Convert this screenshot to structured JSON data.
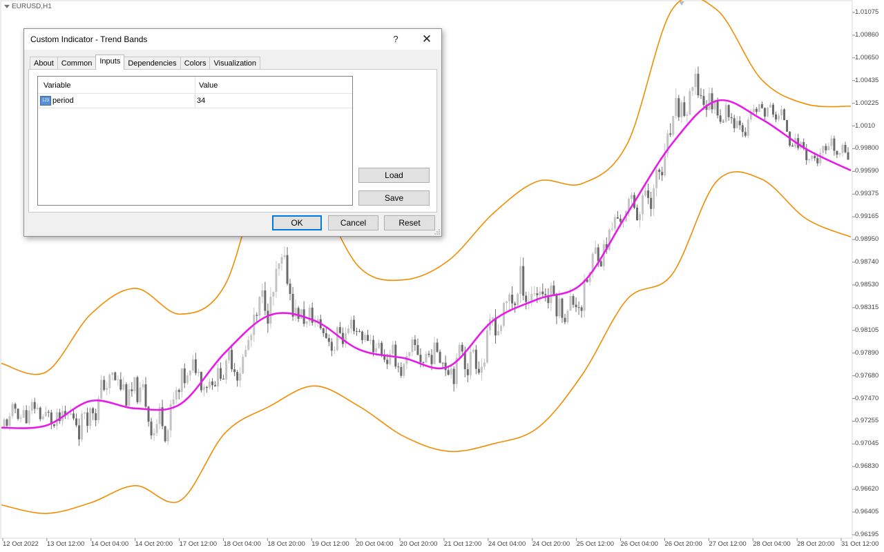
{
  "chart": {
    "symbol": "EURUSD,H1",
    "price_labels": [
      "1.01075",
      "1.00860",
      "1.00650",
      "1.00435",
      "1.00225",
      "1.0010",
      "0.99800",
      "0.99590",
      "0.99375",
      "0.99165",
      "0.98950",
      "0.98740",
      "0.98530",
      "0.98315",
      "0.98105",
      "0.97890",
      "0.97680",
      "0.97470",
      "0.97255",
      "0.97045",
      "0.96830",
      "0.96620",
      "0.96405",
      "0.96195"
    ],
    "time_labels": [
      "12 Oct 2022",
      "13 Oct 12:00",
      "14 Oct 04:00",
      "14 Oct 20:00",
      "17 Oct 12:00",
      "18 Oct 04:00",
      "18 Oct 20:00",
      "19 Oct 12:00",
      "20 Oct 04:00",
      "20 Oct 20:00",
      "21 Oct 12:00",
      "24 Oct 04:00",
      "24 Oct 20:00",
      "25 Oct 12:00",
      "26 Oct 04:00",
      "26 Oct 20:00",
      "27 Oct 12:00",
      "28 Oct 04:00",
      "28 Oct 20:00",
      "31 Oct 12:00"
    ],
    "colors": {
      "bands": "#f28c00",
      "midline": "#e81ae8",
      "candle_up": "#c4c4c4",
      "candle_down": "#6a6a6a"
    }
  },
  "chart_data": {
    "type": "line",
    "title": "",
    "symbol": "EURUSD",
    "timeframe": "H1",
    "ylim": [
      0.96195,
      1.01075
    ],
    "x": [
      "12 Oct 2022",
      "13 Oct 12:00",
      "14 Oct 04:00",
      "14 Oct 20:00",
      "17 Oct 12:00",
      "18 Oct 04:00",
      "18 Oct 20:00",
      "19 Oct 12:00",
      "20 Oct 04:00",
      "20 Oct 20:00",
      "21 Oct 12:00",
      "24 Oct 04:00",
      "24 Oct 20:00",
      "25 Oct 12:00",
      "26 Oct 04:00",
      "26 Oct 20:00",
      "27 Oct 12:00",
      "28 Oct 04:00",
      "28 Oct 20:00",
      "31 Oct 12:00"
    ],
    "series": [
      {
        "values": [
          0.972,
          0.9722,
          0.9745,
          0.9738,
          0.9742,
          0.979,
          0.9825,
          0.982,
          0.9793,
          0.9785,
          0.9777,
          0.982,
          0.984,
          0.9855,
          0.992,
          0.9985,
          1.0025,
          1.0008,
          0.998,
          0.996
        ]
      },
      {
        "values": [
          0.978,
          0.9772,
          0.9826,
          0.985,
          0.9826,
          0.9853,
          0.9973,
          0.9942,
          0.987,
          0.9858,
          0.9876,
          0.992,
          0.995,
          0.9948,
          0.9985,
          1.011,
          1.011,
          1.0045,
          1.0022,
          1.002
        ]
      },
      {
        "values": [
          0.9648,
          0.964,
          0.965,
          0.9666,
          0.9652,
          0.9715,
          0.974,
          0.9759,
          0.974,
          0.9712,
          0.9698,
          0.9705,
          0.972,
          0.977,
          0.984,
          0.9863,
          0.995,
          0.9952,
          0.9915,
          0.9898
        ]
      }
    ]
  },
  "dialog": {
    "title": "Custom Indicator - Trend Bands",
    "help": "?",
    "close": "✕",
    "tabs": [
      "About",
      "Common",
      "Inputs",
      "Dependencies",
      "Colors",
      "Visualization"
    ],
    "active_tab": "Inputs",
    "table": {
      "col_variable": "Variable",
      "col_value": "Value",
      "rows": [
        {
          "variable": "period",
          "value": "34",
          "icon": "123"
        }
      ]
    },
    "load": "Load",
    "save": "Save",
    "ok": "OK",
    "cancel": "Cancel",
    "reset": "Reset"
  }
}
